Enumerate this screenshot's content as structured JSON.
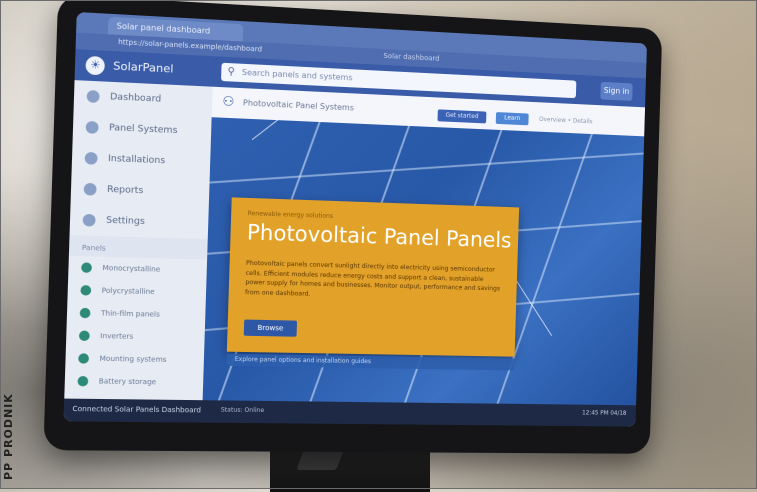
{
  "watermark": "PP PRODNIK",
  "browser": {
    "tab_label": "Solar panel dashboard",
    "address": "https://solar-panels.example/dashboard",
    "address_right": "Solar dashboard"
  },
  "app": {
    "name": "SolarPanel",
    "search_placeholder": "Search panels and systems",
    "action_label": "Sign in"
  },
  "sidebar": {
    "items": [
      {
        "label": "Dashboard"
      },
      {
        "label": "Panel Systems"
      },
      {
        "label": "Installations"
      },
      {
        "label": "Reports"
      },
      {
        "label": "Settings"
      }
    ],
    "section_label": "Panels",
    "sub_items": [
      {
        "label": "Monocrystalline"
      },
      {
        "label": "Polycrystalline"
      },
      {
        "label": "Thin-film panels"
      },
      {
        "label": "Inverters"
      },
      {
        "label": "Mounting systems"
      },
      {
        "label": "Battery storage"
      }
    ]
  },
  "main": {
    "title": "Photovoltaic Panel Systems",
    "button1": "Get started",
    "button2": "Learn",
    "meta": "Overview  •  Details"
  },
  "card": {
    "kicker": "Renewable energy solutions",
    "title": "Photovoltaic Panel Panels",
    "body": "Photovoltaic panels convert sunlight directly into electricity using semiconductor cells. Efficient modules reduce energy costs and support a clean, sustainable power supply for homes and businesses. Monitor output, performance and savings from one dashboard.",
    "button": "Browse",
    "strip": "Explore panel options and installation guides"
  },
  "status": {
    "left": "Connected  Solar Panels  Dashboard",
    "mid": "Status: Online",
    "right": "12:45 PM  04/18"
  }
}
